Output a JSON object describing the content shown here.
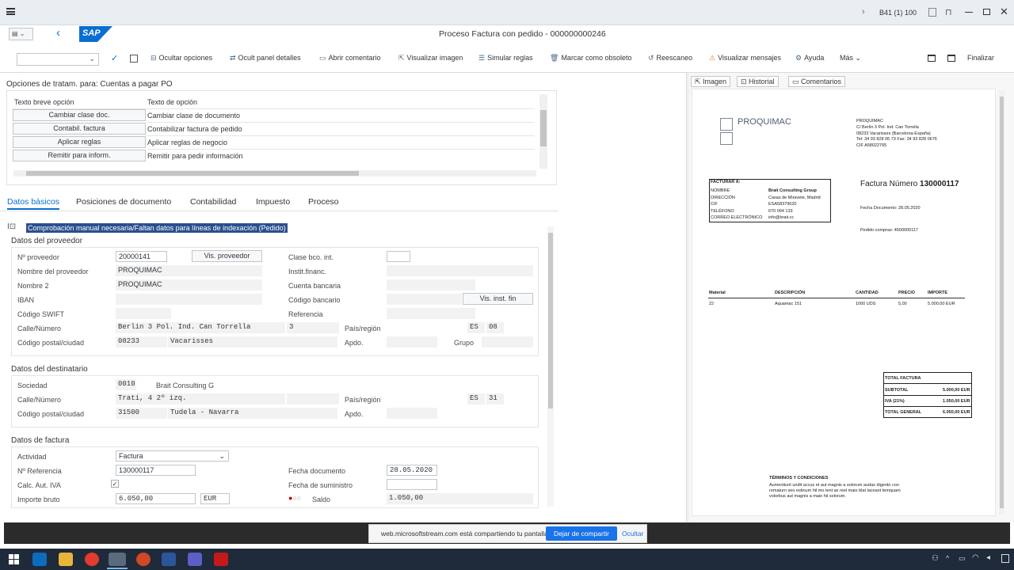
{
  "titlebar": {
    "system_label": "B41 (1) 100"
  },
  "shell": {
    "logo_text": "SAP",
    "title": "Proceso Factura con pedido - 000000000246"
  },
  "toolbar": {
    "items": [
      "Ocultar opciones",
      "Ocult panel detalles",
      "Abrir comentario",
      "Visualizar imagen",
      "Simular reglas",
      "Marcar como obsoleto",
      "Reescaneo",
      "Visualizar mensajes",
      "Ayuda",
      "Más"
    ],
    "finalize": "Finalizar"
  },
  "options": {
    "title": "Opciones de tratam. para: Cuentas a pagar PO",
    "col1": "Texto breve opción",
    "col2": "Texto de opción",
    "rows": [
      {
        "btn": "Cambiar clase doc.",
        "text": "Cambiar clase de documento"
      },
      {
        "btn": "Contabil. factura",
        "text": "Contabilizar factura de pedido"
      },
      {
        "btn": "Aplicar reglas",
        "text": "Aplicar reglas de negocio"
      },
      {
        "btn": "Remitir para inform.",
        "text": "Remitir para pedir información"
      }
    ]
  },
  "tabs": [
    "Datos básicos",
    "Posiciones de documento",
    "Contabilidad",
    "Impuesto",
    "Proceso"
  ],
  "message": "Comprobación manual necesaria/Faltan datos para líneas de indexación (Pedido)",
  "vendor": {
    "title": "Datos del proveedor",
    "labels": {
      "vendor_no": "Nº proveedor",
      "vendor_name": "Nombre del proveedor",
      "name2": "Nombre 2",
      "iban": "IBAN",
      "swift": "Código SWIFT",
      "street": "Calle/Número",
      "postal": "Código postal/ciudad",
      "bank_type": "Clase bco. int.",
      "fin_inst": "Instit.financ.",
      "bank_acct": "Cuenta bancaria",
      "bank_code": "Código bancario",
      "reference": "Referencia",
      "country": "País/región",
      "po_box": "Apdo.",
      "group": "Grupo"
    },
    "values": {
      "vendor_no": "20000141",
      "vendor_name": "PROQUIMAC",
      "name2": "PROQUIMAC",
      "street": "Berlin 3 Pol. Ind. Can Torrella",
      "number": "3",
      "country": "ES",
      "region": "08",
      "postal": "08233",
      "city": "Vacarisses"
    },
    "btn_vendor": "Vis. proveedor",
    "btn_inst": "Vis. inst. fin"
  },
  "recipient": {
    "title": "Datos del destinatario",
    "labels": {
      "company": "Sociedad",
      "street": "Calle/Número",
      "postal": "Código postal/ciudad",
      "country": "País/región",
      "po_box": "Apdo."
    },
    "values": {
      "company": "0010",
      "company_name": "Brait Consulting G",
      "street": "Trati, 4 2º izq.",
      "country": "ES",
      "region": "31",
      "postal": "31500",
      "city": "Tudela - Navarra"
    }
  },
  "invoice": {
    "title": "Datos de factura",
    "labels": {
      "activity": "Actividad",
      "reference": "Nº Referencia",
      "calc_vat": "Calc. Aut. IVA",
      "gross": "Importe bruto",
      "doc_date": "Fecha documento",
      "supply_date": "Fecha de suministro",
      "balance": "Saldo"
    },
    "values": {
      "activity": "Factura",
      "reference": "130000117",
      "calc_vat": "✓",
      "gross": "6.050,00",
      "currency": "EUR",
      "doc_date": "28.05.2020",
      "balance": "1.050,00"
    }
  },
  "right_tabs": [
    "Imagen",
    "Historial",
    "Comentarios"
  ],
  "document": {
    "brand": "PROQUIMAC",
    "header_lines": [
      "PROQUIMAC",
      "C/ Berlín 3 Pol. Ind. Can Torrella",
      "08233 Vacarisses (Barcelona-España)",
      "Tel: 34 93 828 06 73 Fax: 34 93 828 0676",
      "CIF A58022765"
    ],
    "bill_to_title": "FACTURAR A:",
    "bill_to": [
      {
        "k": "NOMBRE",
        "v": "Brait Consulting Group"
      },
      {
        "k": "DIRECCIÓN",
        "v": "Casas de Miravete, Madrid"
      },
      {
        "k": "CIF",
        "v": "ESA58379620"
      },
      {
        "k": "TELÉFONO",
        "v": "670 094 133"
      },
      {
        "k": "CORREO ELECTRÓNICO",
        "v": "info@brait.cc"
      }
    ],
    "invoice_label": "Factura Número",
    "invoice_number": "130000117",
    "doc_date": "Fecha Documento: 28.05.2020",
    "po": "Pedido compras: 4500000117",
    "items_head": [
      "Material",
      "DESCRIPCIÓN",
      "CANTIDAD",
      "PRECIO",
      "IMPORTE"
    ],
    "items": [
      [
        "22",
        "Aquamac 151",
        "1000 UDS",
        "5,00",
        "5.000,00 EUR"
      ]
    ],
    "totals_title": "TOTAL FACTURA",
    "totals": [
      {
        "k": "SUBTOTAL",
        "v": "5.000,00 EUR"
      },
      {
        "k": "IVA (21%)",
        "v": "1.050,00 EUR"
      },
      {
        "k": "TOTAL GENERAL",
        "v": "6.050,00 EUR"
      }
    ],
    "terms_title": "TÉRMINOS Y CONDICIONES",
    "terms": [
      "Aumentiunt undit accus et aut magnis a solorum audas digento con",
      "rematurn seo estinum hil mo tent as reel maio blat laceant temquam",
      "volorbus aut magnis a maio hil solorum."
    ]
  },
  "share": {
    "text": "web.microsoftstream.com está compartiendo tu pantalla.",
    "stop": "Dejar de compartir",
    "hide": "Ocultar"
  },
  "colors": {
    "accent": "#0a6ed1",
    "sap_logo": "#0a6ed1",
    "taskbar": "#1f2a3a"
  }
}
